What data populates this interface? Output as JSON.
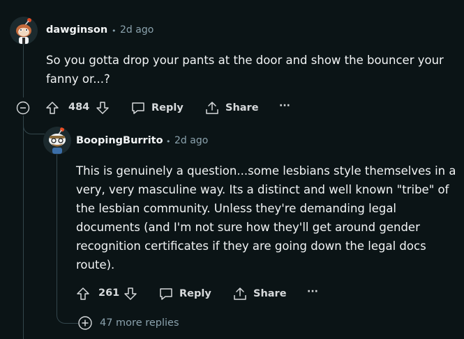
{
  "comments": [
    {
      "username": "dawginson",
      "timestamp": "2d ago",
      "body_line1": "So you gotta drop your pants at the door and show the bouncer your",
      "body_line2": "fanny or...?",
      "votes": "484",
      "reply_label": "Reply",
      "share_label": "Share",
      "more_label": "···"
    },
    {
      "username": "BoopingBurrito",
      "timestamp": "2d ago",
      "body_lines": [
        "This is genuinely a question...some lesbians style themselves in a",
        "very, very masculine way. Its a distinct and well known \"tribe\" of",
        "the lesbian community. Unless they're demanding legal",
        "documents (and I'm not sure how they'll get around gender",
        "recognition certificates if they are going down the legal docs",
        "route)."
      ],
      "votes": "261",
      "reply_label": "Reply",
      "share_label": "Share",
      "more_label": "···"
    }
  ],
  "more_replies": "47 more replies",
  "colors": {
    "background": "#0b1416",
    "text": "#f2f4f5",
    "muted": "#8ba2ad",
    "thread_line": "#33464c"
  }
}
